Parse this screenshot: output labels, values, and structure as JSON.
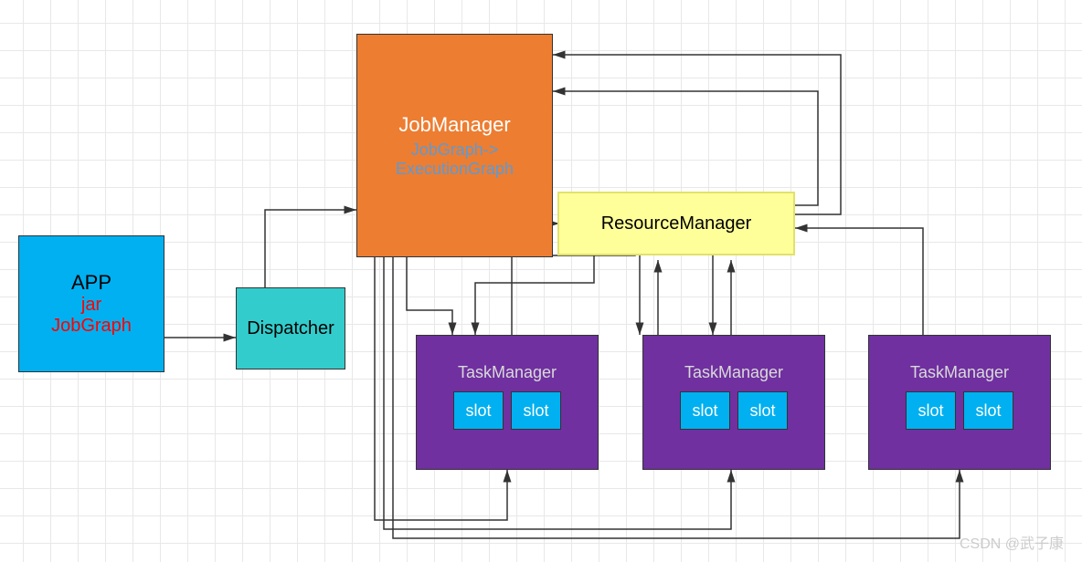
{
  "app": {
    "title": "APP",
    "sub1": "jar",
    "sub2": "JobGraph"
  },
  "dispatcher": {
    "label": "Dispatcher"
  },
  "jobmanager": {
    "title": "JobManager",
    "line1": "JobGraph->",
    "line2": "ExecutionGraph"
  },
  "resourcemanager": {
    "label": "ResourceManager"
  },
  "taskmanager": {
    "label": "TaskManager",
    "slot": "slot"
  },
  "watermark": "CSDN @武子康"
}
